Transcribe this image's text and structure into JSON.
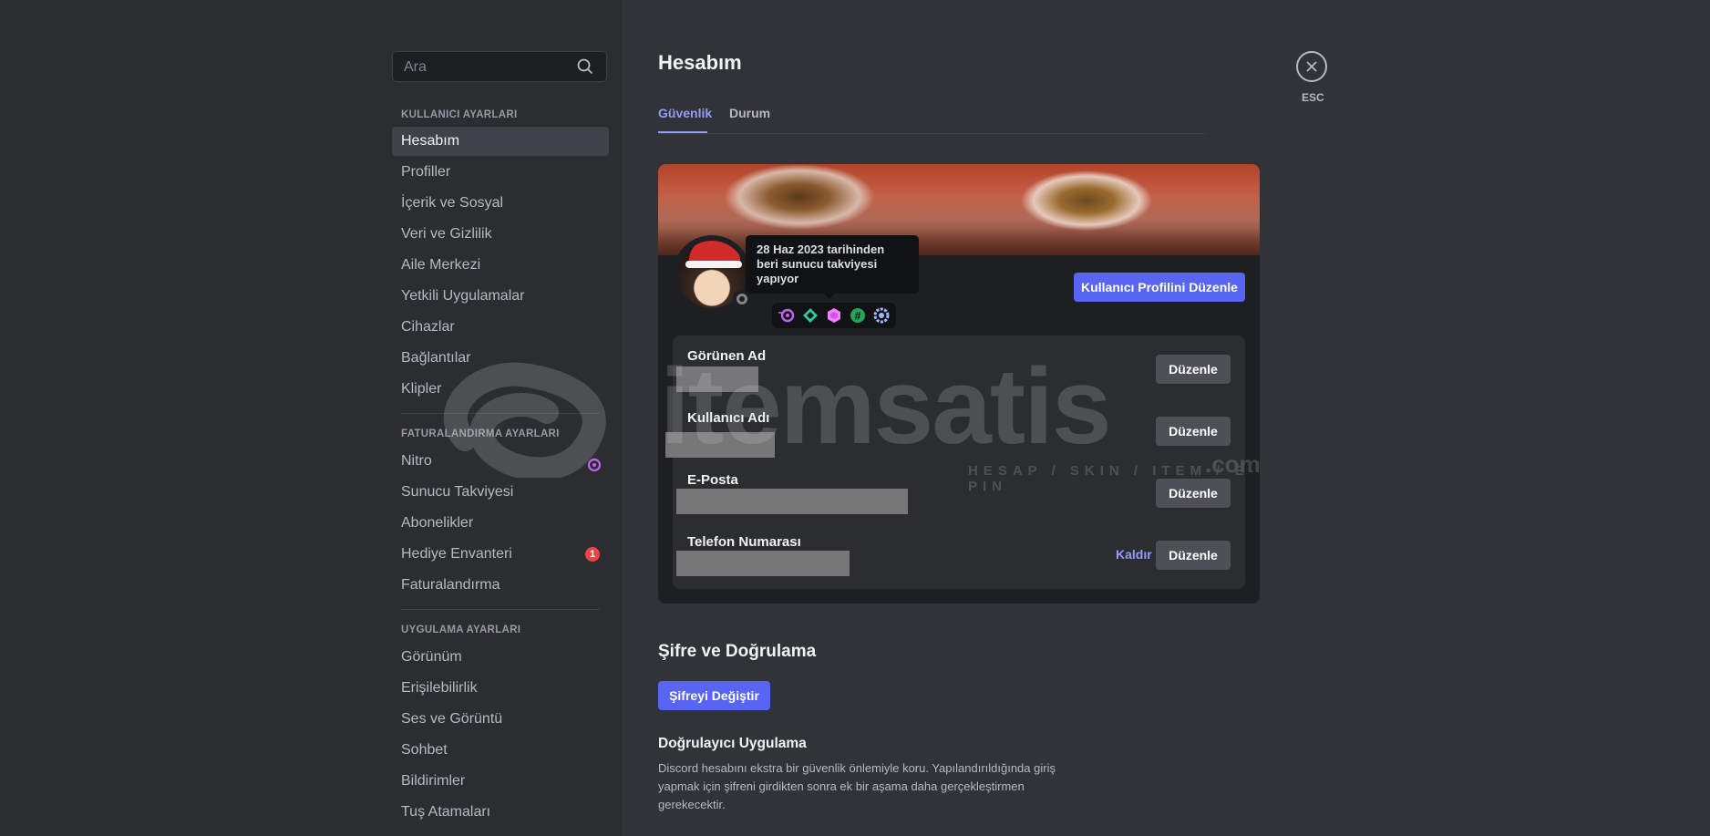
{
  "search": {
    "placeholder": "Ara"
  },
  "sidebar": {
    "sections": [
      {
        "header": "KULLANICI AYARLARI",
        "items": [
          "Hesabım",
          "Profiller",
          "İçerik ve Sosyal",
          "Veri ve Gizlilik",
          "Aile Merkezi",
          "Yetkili Uygulamalar",
          "Cihazlar",
          "Bağlantılar",
          "Klipler"
        ]
      },
      {
        "header": "FATURALANDIRMA AYARLARI",
        "items": [
          "Nitro",
          "Sunucu Takviyesi",
          "Abonelikler",
          "Hediye Envanteri",
          "Faturalandırma"
        ]
      },
      {
        "header": "UYGULAMA AYARLARI",
        "items": [
          "Görünüm",
          "Erişilebilirlik",
          "Ses ve Görüntü",
          "Sohbet",
          "Bildirimler",
          "Tuş Atamaları"
        ]
      }
    ],
    "active_item": "Hesabım",
    "gift_badge_count": "1"
  },
  "main": {
    "title": "Hesabım",
    "tabs": [
      "Güvenlik",
      "Durum"
    ],
    "active_tab": "Güvenlik",
    "close_label": "ESC",
    "tooltip": "28 Haz 2023 tarihinden beri sunucu takviyesi yapıyor",
    "edit_profile_button": "Kullanıcı Profilini Düzenle",
    "badges": [
      "nitro-badge",
      "boost-badge",
      "hypesquad-badge",
      "hashtag-badge",
      "quest-badge"
    ],
    "fields": [
      {
        "label": "Görünen Ad",
        "action": "Düzenle"
      },
      {
        "label": "Kullanıcı Adı",
        "action": "Düzenle"
      },
      {
        "label": "E-Posta",
        "action": "Düzenle"
      },
      {
        "label": "Telefon Numarası",
        "action": "Düzenle",
        "remove": "Kaldır"
      }
    ],
    "password_section": {
      "title": "Şifre ve Doğrulama",
      "change_password_button": "Şifreyi Değiştir",
      "authenticator_title": "Doğrulayıcı Uygulama",
      "authenticator_desc": "Discord hesabını ekstra bir güvenlik önlemiyle koru. Yapılandırıldığında giriş yapmak için şifreni girdikten sonra ek bir aşama daha gerçekleştirmen gerekecektir."
    }
  },
  "watermark": {
    "text": "itemsatis",
    "sub": "HESAP / SKIN / ITEM / E-PIN",
    "suffix": ".com"
  },
  "colors": {
    "accent": "#5865f2",
    "link": "#949cf7",
    "sidebar_bg": "#2b2d31",
    "content_bg": "#313338",
    "danger": "#f23f43"
  }
}
